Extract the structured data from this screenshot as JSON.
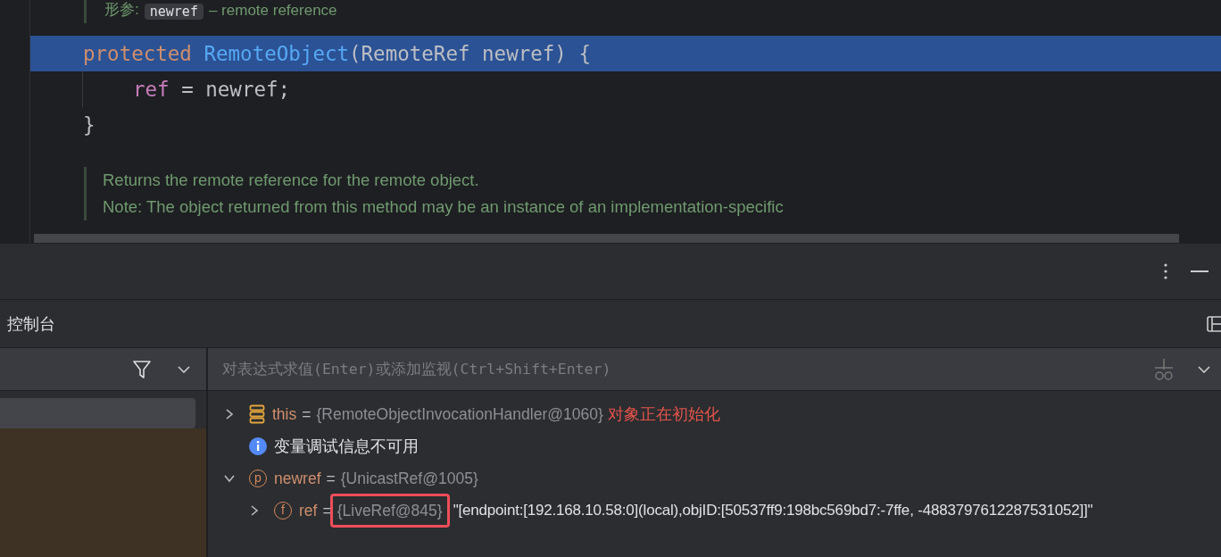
{
  "editor": {
    "doc_params": {
      "label": "形参:",
      "param": "newref",
      "text": "– remote reference"
    },
    "code_lines": [
      {
        "tokens": [
          {
            "kind": "keyword",
            "text": "protected "
          },
          {
            "kind": "method",
            "text": "RemoteObject"
          },
          {
            "kind": "plain",
            "text": "(RemoteRef newref) {"
          }
        ],
        "selected": true,
        "children": [
          {
            "tokens": [
              {
                "kind": "field",
                "text": "ref"
              },
              {
                "kind": "plain",
                "text": " = newref;"
              }
            ],
            "selected": false
          }
        ]
      },
      {
        "tokens": [
          {
            "kind": "plain",
            "text": "}"
          }
        ],
        "selected": false
      }
    ],
    "doc_lines": [
      "Returns the remote reference for the remote object.",
      "Note: The object returned from this method may be an instance of an implementation-specific"
    ]
  },
  "panel": {
    "tab": "控制台",
    "frames": [
      {
        "selected": true
      }
    ],
    "eval_placeholder": "对表达式求值(Enter)或添加监视(Ctrl+Shift+Enter)",
    "variables": [
      {
        "kind": "object",
        "expanded": false,
        "name": "this",
        "sep": "=",
        "value": "{RemoteObjectInvocationHandler@1060}",
        "note": "对象正在初始化"
      },
      {
        "kind": "info",
        "text": "变量调试信息不可用"
      },
      {
        "kind": "param",
        "badge": "p",
        "expanded": true,
        "name": "newref",
        "sep": "=",
        "value": "{UnicastRef@1005}",
        "children": [
          {
            "kind": "field",
            "badge": "f",
            "expanded": false,
            "name": "ref",
            "sep": "=",
            "value": "{LiveRef@845}",
            "boxed": true,
            "string": "\"[endpoint:[192.168.10.58:0](local),objID:[50537ff9:198bc569bd7:-7ffe, -4883797612287531052]]\""
          }
        ]
      }
    ]
  }
}
